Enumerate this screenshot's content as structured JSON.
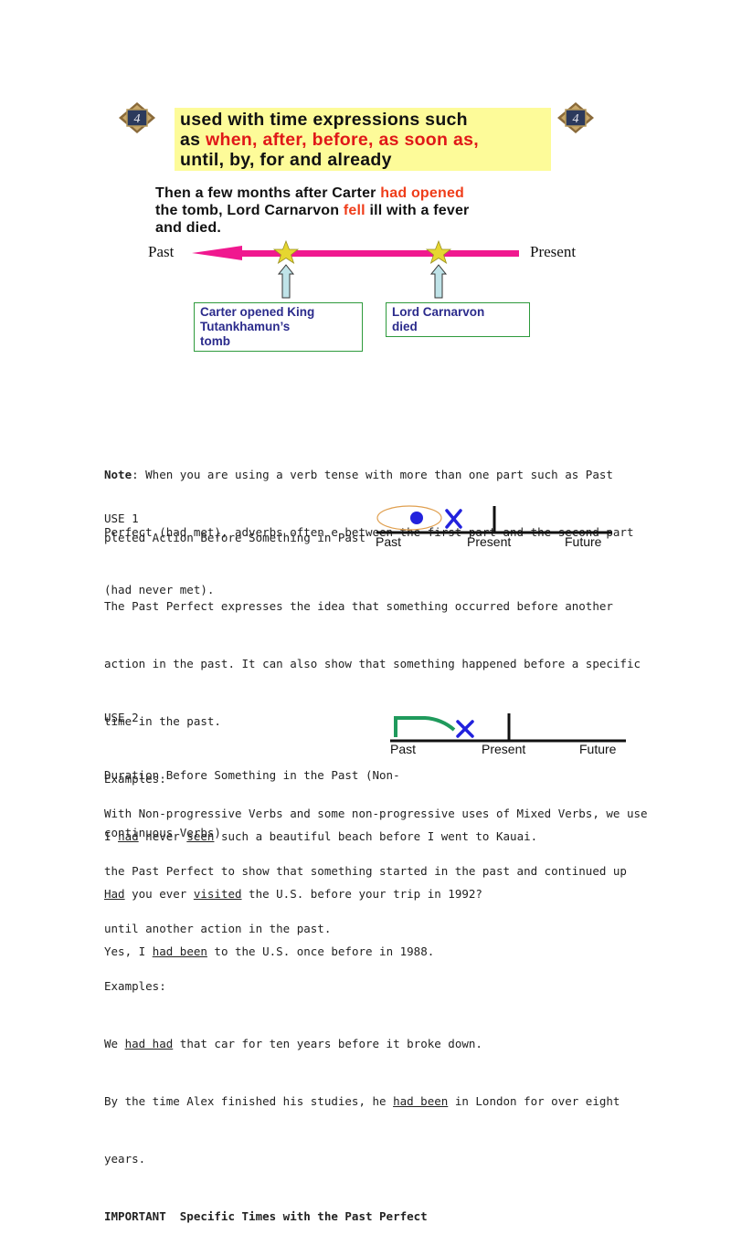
{
  "slide": {
    "badge_number": "4",
    "rule_line1": "used with time expressions such",
    "rule_line2_prefix": "as ",
    "rule_line2_highlight": "when, after, before, as soon as,",
    "rule_line3_highlight": "until, by, for and already",
    "sentence": {
      "part1": "Then a few months after Carter ",
      "highlight1": "had opened",
      "part2": "the tomb, Lord Carnarvon ",
      "highlight2": "fell",
      "part3": " ill with a fever",
      "part4": "and died."
    },
    "timeline": {
      "left_label": "Past",
      "right_label": "Present",
      "events": [
        {
          "label_lines": [
            "Carter opened King",
            "Tutankhamun’s",
            "tomb"
          ]
        },
        {
          "label_lines": [
            "Lord Carnarvon",
            "died"
          ]
        }
      ]
    },
    "colors": {
      "highlight_bg": "#fdfb99",
      "arrow": "#f0188f",
      "red_text": "#e01818",
      "box_border": "#2e9a3c",
      "box_text": "#2b2b8c"
    }
  },
  "note": {
    "label": "Note",
    "line1": ": When you are using a verb tense with more than one part such as Past",
    "line2": "Perfect (had met), adverbs often e between the first part and the second part",
    "line3": "(had never met)."
  },
  "use1": {
    "heading": "USE 1",
    "title": "pleted Action Before Something in Past",
    "diagram_labels": [
      "Past",
      "Present",
      "Future"
    ],
    "desc_lines": [
      "The Past Perfect expresses the idea that something occurred before another",
      "action in the past. It can also show that something happened before a specific",
      "time in the past."
    ],
    "examples_label": "Examples:",
    "examples": [
      {
        "segments": [
          {
            "t": "I "
          },
          {
            "t": "had",
            "u": true
          },
          {
            "t": " never "
          },
          {
            "t": "seen",
            "u": true
          },
          {
            "t": " such a beautiful beach before I went to Kauai."
          }
        ]
      },
      {
        "segments": [
          {
            "t": "Had",
            "u": true
          },
          {
            "t": " you ever "
          },
          {
            "t": "visited",
            "u": true
          },
          {
            "t": " the U.S. before your trip in 1992?"
          }
        ]
      },
      {
        "segments": [
          {
            "t": "Yes, I "
          },
          {
            "t": "had been",
            "u": true
          },
          {
            "t": " to the U.S. once before in 1988."
          }
        ]
      }
    ]
  },
  "use2": {
    "heading": "USE 2",
    "title_line1": "Duration Before Something in the Past (Non-",
    "title_line2": "continuous Verbs)",
    "diagram_labels": [
      "Past",
      "Present",
      "Future"
    ],
    "desc_lines": [
      "With Non-progressive Verbs and some non-progressive uses of Mixed Verbs, we use",
      "the Past Perfect to show that something started in the past and continued up",
      "until another action in the past."
    ],
    "examples_label": "Examples:",
    "examples": [
      {
        "segments": [
          {
            "t": "We "
          },
          {
            "t": "had had",
            "u": true
          },
          {
            "t": " that car for ten years before it broke down."
          }
        ]
      },
      {
        "segments": [
          {
            "t": "By the time Alex finished his studies, he "
          },
          {
            "t": "had been",
            "u": true
          },
          {
            "t": " in London for over eight"
          }
        ]
      },
      {
        "segments": [
          {
            "t": "years."
          }
        ]
      }
    ],
    "important": "IMPORTANT  Specific Times with the Past Perfect"
  }
}
